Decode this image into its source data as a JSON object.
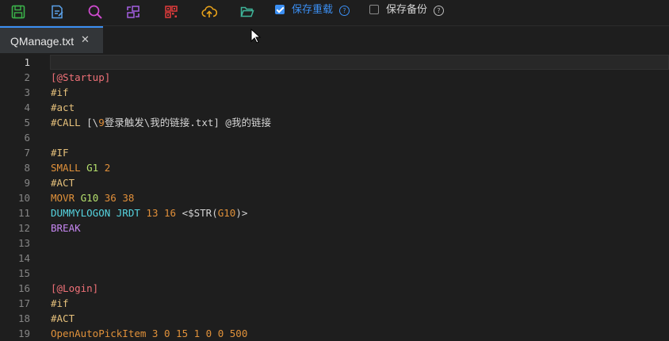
{
  "toolbar": {
    "icons": [
      {
        "name": "save-icon",
        "color": "#3bb34a"
      },
      {
        "name": "edit-file-icon",
        "color": "#5aa0e8"
      },
      {
        "name": "search-icon",
        "color": "#d04bd0"
      },
      {
        "name": "convert-icon",
        "color": "#a45fe0"
      },
      {
        "name": "qrcode-icon",
        "color": "#e03b3b"
      },
      {
        "name": "cloud-upload-icon",
        "color": "#e8a21a"
      },
      {
        "name": "folder-open-icon",
        "color": "#3fb59a"
      }
    ],
    "save_reload": {
      "label": "保存重载",
      "checked": true,
      "color": "#3b8ff3"
    },
    "save_backup": {
      "label": "保存备份",
      "checked": false,
      "color": "#d4d4d4"
    },
    "help_glyph": "?"
  },
  "tabs": [
    {
      "label": "QManage.txt",
      "active": true,
      "close_glyph": "✕"
    }
  ],
  "editor": {
    "current_line": 1,
    "lines": [
      {
        "n": "1",
        "tokens": []
      },
      {
        "n": "2",
        "tokens": [
          {
            "t": "[@Startup]",
            "c": "section"
          }
        ]
      },
      {
        "n": "3",
        "tokens": [
          {
            "t": "#if",
            "c": "hash"
          }
        ]
      },
      {
        "n": "4",
        "tokens": [
          {
            "t": "#act",
            "c": "hash"
          }
        ]
      },
      {
        "n": "5",
        "tokens": [
          {
            "t": "#CALL ",
            "c": "hash"
          },
          {
            "t": "[\\",
            "c": "plain"
          },
          {
            "t": "9",
            "c": "num"
          },
          {
            "t": "登录触发\\我的链接.txt] @我的链接",
            "c": "plain"
          }
        ]
      },
      {
        "n": "6",
        "tokens": []
      },
      {
        "n": "7",
        "tokens": [
          {
            "t": "#IF",
            "c": "hash"
          }
        ]
      },
      {
        "n": "8",
        "tokens": [
          {
            "t": "SMALL ",
            "c": "orange"
          },
          {
            "t": "G1 ",
            "c": "green"
          },
          {
            "t": "2",
            "c": "num"
          }
        ]
      },
      {
        "n": "9",
        "tokens": [
          {
            "t": "#ACT",
            "c": "hash"
          }
        ]
      },
      {
        "n": "10",
        "tokens": [
          {
            "t": "MOVR ",
            "c": "orange"
          },
          {
            "t": "G10 ",
            "c": "green"
          },
          {
            "t": "36 38",
            "c": "num"
          }
        ]
      },
      {
        "n": "11",
        "tokens": [
          {
            "t": "DUMMYLOGON JRDT ",
            "c": "cyan"
          },
          {
            "t": "13 16 ",
            "c": "num"
          },
          {
            "t": "<$STR(",
            "c": "plain"
          },
          {
            "t": "G10",
            "c": "orange"
          },
          {
            "t": ")>",
            "c": "plain"
          }
        ]
      },
      {
        "n": "12",
        "tokens": [
          {
            "t": "BREAK",
            "c": "purple"
          }
        ]
      },
      {
        "n": "13",
        "tokens": []
      },
      {
        "n": "14",
        "tokens": []
      },
      {
        "n": "15",
        "tokens": []
      },
      {
        "n": "16",
        "tokens": [
          {
            "t": "[@Login]",
            "c": "section"
          }
        ]
      },
      {
        "n": "17",
        "tokens": [
          {
            "t": "#if",
            "c": "hash"
          }
        ]
      },
      {
        "n": "18",
        "tokens": [
          {
            "t": "#ACT",
            "c": "hash"
          }
        ]
      },
      {
        "n": "19",
        "tokens": [
          {
            "t": "OpenAutoPickItem 3 0 15 1 0 0 500",
            "c": "orange"
          }
        ]
      }
    ]
  }
}
